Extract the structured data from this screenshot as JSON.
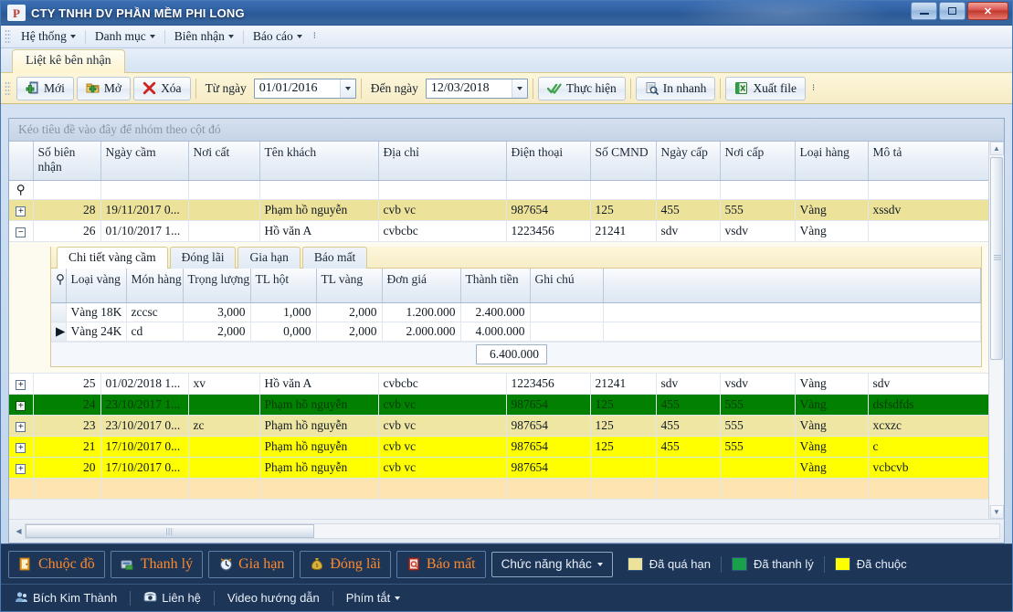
{
  "window": {
    "title": "CTY TNHH DV PHẦN MỀM PHI LONG",
    "app_icon": "P",
    "minimize": "minimize-icon",
    "maximize": "maximize-icon",
    "close": "✕"
  },
  "menu": {
    "items": [
      {
        "label": "Hệ thống",
        "has_caret": true
      },
      {
        "label": "Danh mục",
        "has_caret": true
      },
      {
        "label": "Biên nhận",
        "has_caret": true
      },
      {
        "label": "Báo cáo",
        "has_caret": true
      }
    ],
    "overflow": "⋮"
  },
  "tabs": [
    {
      "label": "Liệt kê bên nhận",
      "active": true
    }
  ],
  "toolbar": {
    "new_label": "Mới",
    "open_label": "Mở",
    "delete_label": "Xóa",
    "from_date_label": "Từ ngày",
    "from_date_value": "01/01/2016",
    "to_date_label": "Đến ngày",
    "to_date_value": "12/03/2018",
    "execute_label": "Thực hiện",
    "print_label": "In nhanh",
    "export_label": "Xuất file"
  },
  "grid": {
    "group_hint": "Kéo tiêu đề vào đây để nhóm theo cột đó",
    "columns": [
      "Số biên nhận",
      "Ngày cầm",
      "Nơi cất",
      "Tên khách",
      "Địa chỉ",
      "Điện thoại",
      "Số CMND",
      "Ngày cấp",
      "Nơi cấp",
      "Loại hàng",
      "Mô tả"
    ],
    "rows": [
      {
        "style": "khaki",
        "expander": "+",
        "so_bien_nhan": "28",
        "ngay_cam": "19/11/2017 0...",
        "noi_cat": "",
        "ten_khach": "Phạm hồ nguyễn",
        "dia_chi": "cvb vc",
        "dien_thoai": "987654",
        "so_cmnd": "125",
        "ngay_cap": "455",
        "noi_cap": "555",
        "loai_hang": "Vàng",
        "mo_ta": "xssdv"
      },
      {
        "style": "white",
        "expander": "−",
        "so_bien_nhan": "26",
        "ngay_cam": "01/10/2017 1...",
        "noi_cat": "",
        "ten_khach": "Hồ văn A",
        "dia_chi": "cvbcbc",
        "dien_thoai": "1223456",
        "so_cmnd": "21241",
        "ngay_cap": "sdv",
        "noi_cap": "vsdv",
        "loai_hang": "Vàng",
        "mo_ta": ""
      },
      {
        "style": "white",
        "expander": "+",
        "so_bien_nhan": "25",
        "ngay_cam": "01/02/2018 1...",
        "noi_cat": "xv",
        "ten_khach": "Hồ văn A",
        "dia_chi": "cvbcbc",
        "dien_thoai": "1223456",
        "so_cmnd": "21241",
        "ngay_cap": "sdv",
        "noi_cap": "vsdv",
        "loai_hang": "Vàng",
        "mo_ta": "sdv"
      },
      {
        "style": "green",
        "expander": "+",
        "so_bien_nhan": "24",
        "ngay_cam": "23/10/2017 1...",
        "noi_cat": "",
        "ten_khach": "Phạm hồ nguyễn",
        "dia_chi": "cvb vc",
        "dien_thoai": "987654",
        "so_cmnd": "125",
        "ngay_cap": "455",
        "noi_cap": "555",
        "loai_hang": "Vàng",
        "mo_ta": "dsfsdfds"
      },
      {
        "style": "khaki2",
        "expander": "+",
        "so_bien_nhan": "23",
        "ngay_cam": "23/10/2017 0...",
        "noi_cat": "zc",
        "ten_khach": "Phạm hồ nguyễn",
        "dia_chi": "cvb vc",
        "dien_thoai": "987654",
        "so_cmnd": "125",
        "ngay_cap": "455",
        "noi_cap": "555",
        "loai_hang": "Vàng",
        "mo_ta": "xcxzc"
      },
      {
        "style": "yellow",
        "expander": "+",
        "so_bien_nhan": "21",
        "ngay_cam": "17/10/2017 0...",
        "noi_cat": "",
        "ten_khach": "Phạm hồ nguyễn",
        "dia_chi": "cvb vc",
        "dien_thoai": "987654",
        "so_cmnd": "125",
        "ngay_cap": "455",
        "noi_cap": "555",
        "loai_hang": "Vàng",
        "mo_ta": "c"
      },
      {
        "style": "yellow",
        "expander": "+",
        "so_bien_nhan": "20",
        "ngay_cam": "17/10/2017 0...",
        "noi_cat": "",
        "ten_khach": "Phạm hồ nguyễn",
        "dia_chi": "cvb vc",
        "dien_thoai": "987654",
        "so_cmnd": "",
        "ngay_cap": "",
        "noi_cap": "",
        "loai_hang": "Vàng",
        "mo_ta": "vcbcvb"
      }
    ]
  },
  "detail": {
    "tabs": [
      {
        "label": "Chi tiết vàng cầm",
        "active": true
      },
      {
        "label": "Đóng lãi",
        "active": false
      },
      {
        "label": "Gia hạn",
        "active": false
      },
      {
        "label": "Báo mất",
        "active": false
      }
    ],
    "columns": [
      "Loại vàng",
      "Món hàng",
      "Trọng lượng",
      "TL hột",
      "TL vàng",
      "Đơn giá",
      "Thành tiền",
      "Ghi chú"
    ],
    "rows": [
      {
        "indicator": "",
        "loai_vang": "Vàng 18K",
        "mon_hang": "zccsc",
        "trong_luong": "3,000",
        "tl_hot": "1,000",
        "tl_vang": "2,000",
        "don_gia": "1.200.000",
        "thanh_tien": "2.400.000",
        "ghi_chu": ""
      },
      {
        "indicator": "▶",
        "loai_vang": "Vàng 24K",
        "mon_hang": "cd",
        "trong_luong": "2,000",
        "tl_hot": "0,000",
        "tl_vang": "2,000",
        "don_gia": "2.000.000",
        "thanh_tien": "4.000.000",
        "ghi_chu": ""
      }
    ],
    "total": "6.400.000"
  },
  "actions": {
    "buttons": [
      {
        "label": "Chuộc đồ",
        "icon": "door-icon",
        "glyph": "🚪"
      },
      {
        "label": "Thanh lý",
        "icon": "cash-register-icon",
        "glyph": "💳"
      },
      {
        "label": "Gia hạn",
        "icon": "clock-icon",
        "glyph": "⏰"
      },
      {
        "label": "Đóng lãi",
        "icon": "money-bag-icon",
        "glyph": "💰"
      },
      {
        "label": "Báo mất",
        "icon": "alert-book-icon",
        "glyph": "📕"
      }
    ],
    "other_functions": "Chức năng khác"
  },
  "legend": [
    {
      "label": "Đã quá hạn",
      "color": "#ece29a"
    },
    {
      "label": "Đã thanh lý",
      "color": "#18a04a"
    },
    {
      "label": "Đã chuộc",
      "color": "#ffff00"
    }
  ],
  "statusbar": {
    "user": "Bích Kim Thành",
    "contact": "Liên hệ",
    "video": "Video hướng dẫn",
    "shortcuts": "Phím tắt"
  }
}
